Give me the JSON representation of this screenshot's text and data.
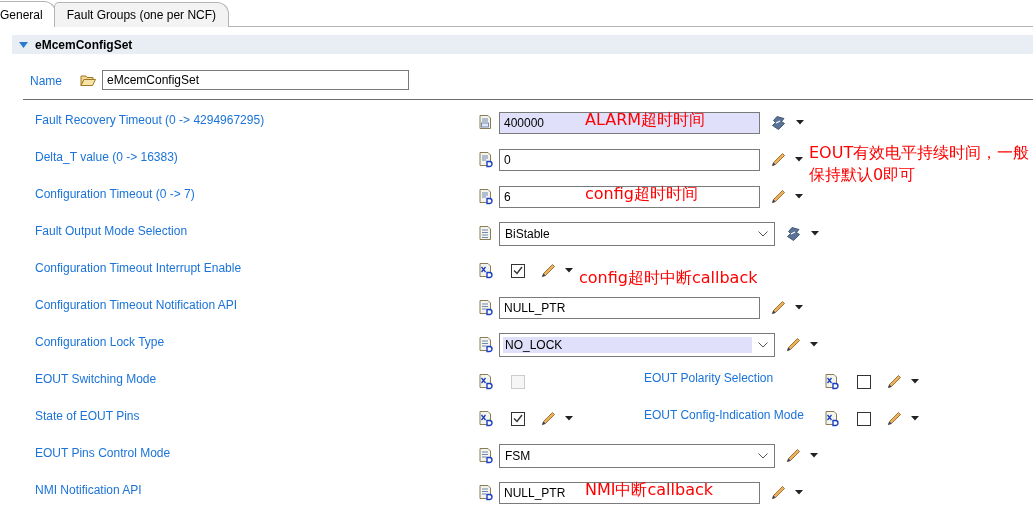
{
  "tabs": [
    {
      "label": "General",
      "selected": true
    },
    {
      "label": "Fault Groups (one per NCF)",
      "selected": false
    }
  ],
  "section": {
    "title": "eMcemConfigSet",
    "expanded": true,
    "name_label": "Name",
    "name_value": "eMcemConfigSet"
  },
  "rows": [
    {
      "label": "Fault Recovery Timeout (0 -> 4294967295)",
      "kind": "text",
      "type_icon": {
        "kind": "number"
      },
      "value": "400000",
      "highlighted": true,
      "action": {
        "kind": "calc"
      },
      "note": {
        "text": "ALARM超时时间",
        "kind": "over"
      }
    },
    {
      "label": "Delta_T value (0 -> 16383)",
      "kind": "text",
      "type_icon": {
        "kind": "number-default"
      },
      "value": "0",
      "highlighted": false,
      "action": {
        "kind": "edit"
      },
      "note": {
        "text": "EOUT有效电平持续时间，一般保持默认0即可",
        "kind": "aside"
      }
    },
    {
      "label": "Configuration Timeout (0 -> 7)",
      "kind": "text",
      "type_icon": {
        "kind": "number-default"
      },
      "value": "6",
      "highlighted": false,
      "action": {
        "kind": "edit"
      },
      "note": {
        "text": "config超时时间",
        "kind": "over"
      }
    },
    {
      "label": "Fault Output Mode Selection",
      "kind": "combo",
      "type_icon": {
        "kind": "list"
      },
      "value": "BiStable",
      "highlighted": false,
      "action": {
        "kind": "calc"
      }
    },
    {
      "label": "Configuration Timeout Interrupt Enable",
      "kind": "checkbox",
      "type_icon": {
        "kind": "boolean-default"
      },
      "checked": true,
      "disabled": false,
      "action": {
        "kind": "edit"
      },
      "note": {
        "text": "config超时中断callback",
        "kind": "aside"
      }
    },
    {
      "label": "Configuration Timeout Notification API",
      "kind": "text",
      "type_icon": {
        "kind": "text-default"
      },
      "value": "NULL_PTR",
      "highlighted": false,
      "action": {
        "kind": "edit"
      }
    },
    {
      "label": "Configuration Lock Type",
      "kind": "combo",
      "type_icon": {
        "kind": "text-default"
      },
      "value": "NO_LOCK",
      "highlighted": true,
      "action": {
        "kind": "edit"
      }
    },
    {
      "label": "EOUT Switching Mode",
      "kind": "checkbox",
      "type_icon": {
        "kind": "boolean-default"
      },
      "checked": false,
      "disabled": true,
      "pair": {
        "label": "EOUT Polarity Selection",
        "type_icon": {
          "kind": "boolean-default"
        },
        "checked": false,
        "disabled": false,
        "action": {
          "kind": "edit"
        }
      }
    },
    {
      "label": "State of EOUT Pins",
      "kind": "checkbox",
      "type_icon": {
        "kind": "boolean-default"
      },
      "checked": true,
      "disabled": false,
      "action": {
        "kind": "edit"
      },
      "pair": {
        "label": "EOUT Config-Indication Mode",
        "type_icon": {
          "kind": "boolean-default"
        },
        "checked": false,
        "disabled": false,
        "action": {
          "kind": "edit"
        }
      }
    },
    {
      "label": "EOUT Pins Control Mode",
      "kind": "combo",
      "type_icon": {
        "kind": "text-default"
      },
      "value": "FSM",
      "highlighted": false,
      "action": {
        "kind": "edit"
      }
    },
    {
      "label": "NMI Notification API",
      "kind": "text",
      "type_icon": {
        "kind": "text-default"
      },
      "value": "NULL_PTR",
      "highlighted": false,
      "action": {
        "kind": "edit"
      },
      "note": {
        "text": "NMI中断callback",
        "kind": "over"
      }
    }
  ]
}
